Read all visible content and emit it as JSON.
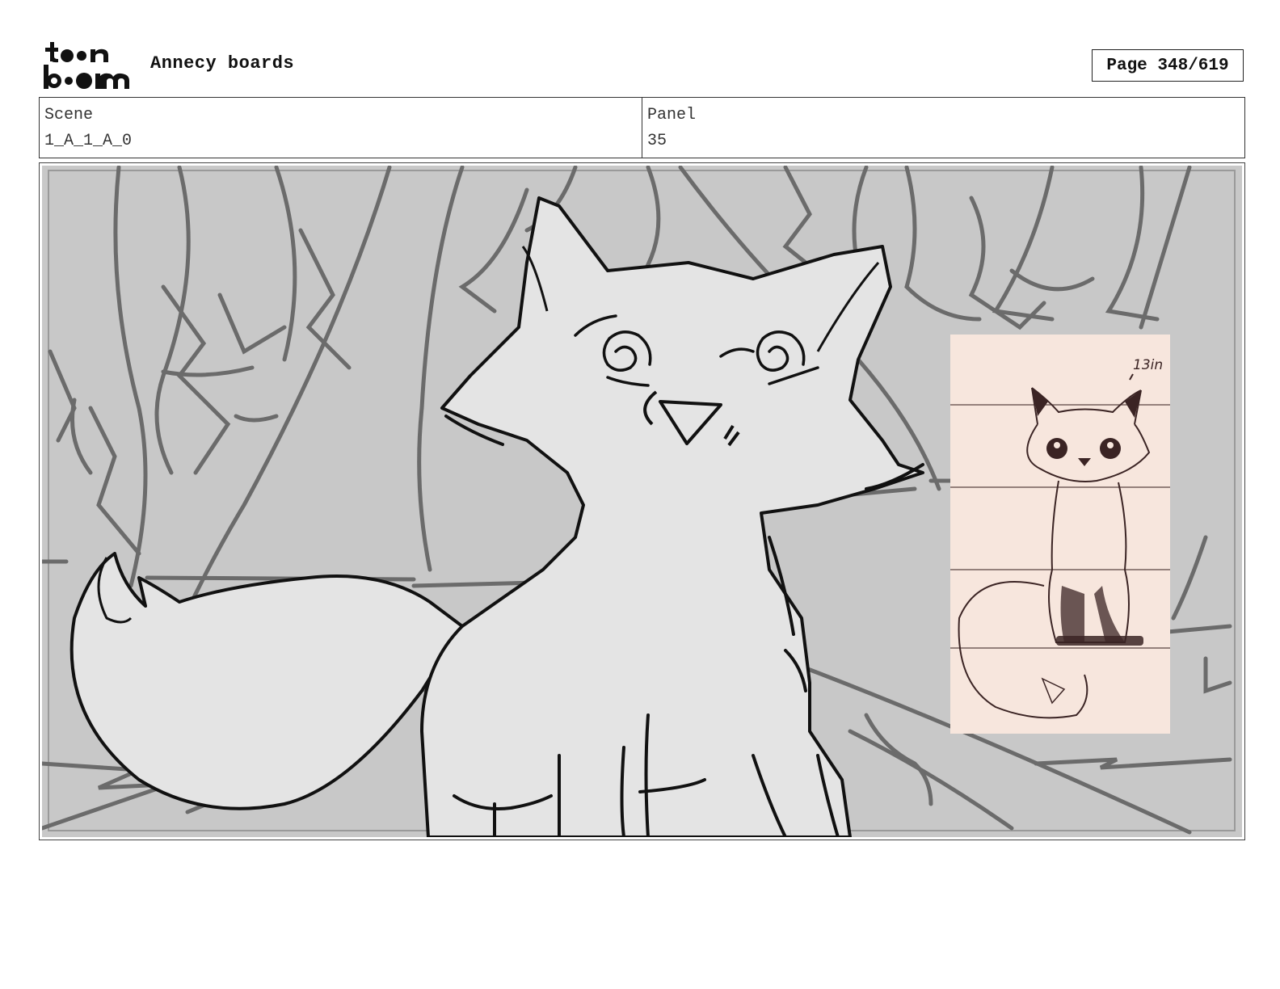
{
  "header": {
    "logo_text": "toon boom",
    "doc_title": "Annecy boards",
    "page_label": "Page 348/619"
  },
  "meta": {
    "scene_label": "Scene",
    "scene_value": "1_A_1_A_0",
    "panel_label": "Panel",
    "panel_value": "35"
  },
  "reference_card": {
    "height_note": "13in"
  },
  "colors": {
    "background_gray": "#c8c8c8",
    "tree_line": "#6b6b6b",
    "fox_fill": "#e4e4e4",
    "reference_card": "#f7e6dd",
    "reference_ink": "#3b2424"
  }
}
